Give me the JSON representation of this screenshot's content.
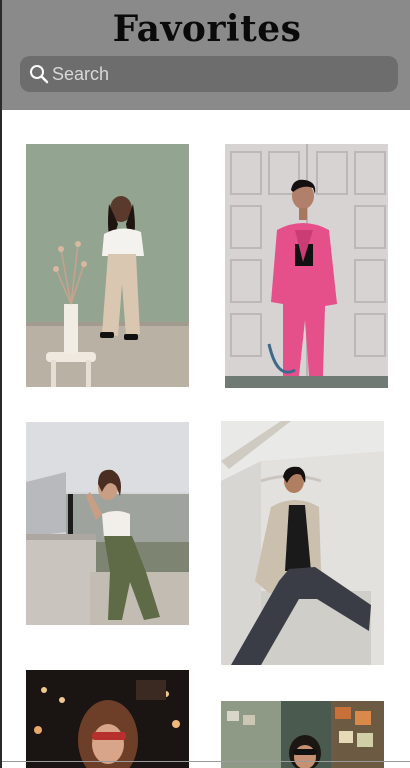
{
  "header": {
    "title": "Favorites"
  },
  "search": {
    "placeholder": "Search",
    "icon": "search-icon"
  },
  "photos": [
    {
      "name": "photo-woman-white-top-beige-pants",
      "icon": "photo"
    },
    {
      "name": "photo-woman-pink-suit",
      "icon": "photo"
    },
    {
      "name": "photo-woman-white-top-green-pants",
      "icon": "photo"
    },
    {
      "name": "photo-woman-beige-blazer-black-pants",
      "icon": "photo"
    },
    {
      "name": "photo-woman-curly-hair-sunglasses",
      "icon": "photo"
    },
    {
      "name": "photo-woman-sunglasses-shop",
      "icon": "photo"
    }
  ],
  "colors": {
    "header_bg": "#8a8a8a",
    "search_bg": "#6d6d6d",
    "title": "#0a0a0a"
  }
}
